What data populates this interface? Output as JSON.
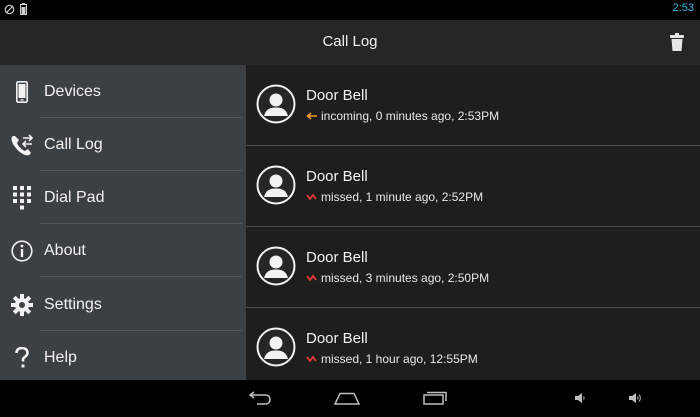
{
  "status_bar": {
    "time": "2:53",
    "icons": [
      "sync-icon",
      "battery-icon"
    ]
  },
  "action_bar": {
    "title": "Call Log",
    "action_icon": "trash-icon"
  },
  "drawer": {
    "items": [
      {
        "label": "Devices",
        "icon": "phone-device-icon"
      },
      {
        "label": "Call Log",
        "icon": "call-log-icon"
      },
      {
        "label": "Dial Pad",
        "icon": "dial-pad-icon"
      },
      {
        "label": "About",
        "icon": "info-icon"
      },
      {
        "label": "Settings",
        "icon": "gear-icon"
      },
      {
        "label": "Help",
        "icon": "question-icon"
      }
    ]
  },
  "call_log": {
    "entries": [
      {
        "name": "Door Bell",
        "detail": "incoming, 0 minutes ago, 2:53PM",
        "type": "incoming",
        "icon": "incoming-arrow-icon",
        "color": "#f29b1d"
      },
      {
        "name": "Door Bell",
        "detail": "missed, 1 minute ago, 2:52PM",
        "type": "missed",
        "icon": "missed-call-icon",
        "color": "#e53935"
      },
      {
        "name": "Door Bell",
        "detail": "missed, 3 minutes ago, 2:50PM",
        "type": "missed",
        "icon": "missed-call-icon",
        "color": "#e53935"
      },
      {
        "name": "Door Bell",
        "detail": "missed, 1 hour ago, 12:55PM",
        "type": "missed",
        "icon": "missed-call-icon",
        "color": "#e53935"
      }
    ]
  },
  "nav_bar": {
    "icons": [
      "back-icon",
      "home-icon",
      "recents-icon",
      "volume-down-icon",
      "volume-up-icon"
    ]
  },
  "colors": {
    "accent": "#33b5e5",
    "drawer_bg": "#3b4044",
    "list_bg": "#1e1e1e",
    "action_bar_bg": "#262626"
  }
}
